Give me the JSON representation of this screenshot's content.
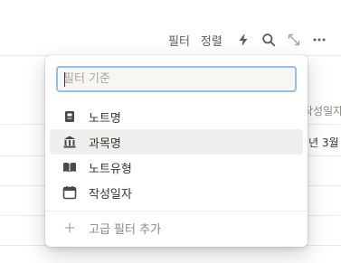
{
  "toolbar": {
    "filter_label": "필터",
    "sort_label": "정렬",
    "icons": [
      "lightning-icon",
      "search-icon",
      "expand-icon",
      "more-icon"
    ]
  },
  "background": {
    "header_partial": "작성일자",
    "row1_partial": "년 3월"
  },
  "filter_menu": {
    "search_placeholder": "필터 기준",
    "options": [
      {
        "label": "노트명",
        "icon": "note-icon"
      },
      {
        "label": "과목명",
        "icon": "building-icon"
      },
      {
        "label": "노트유형",
        "icon": "book-icon"
      },
      {
        "label": "작성일자",
        "icon": "calendar-icon"
      }
    ],
    "advanced_label": "고급 필터 추가"
  },
  "colors": {
    "focus_border": "#8fc1ea",
    "hover_bg": "#efefee",
    "text": "#37352f",
    "muted": "#8a8984"
  }
}
